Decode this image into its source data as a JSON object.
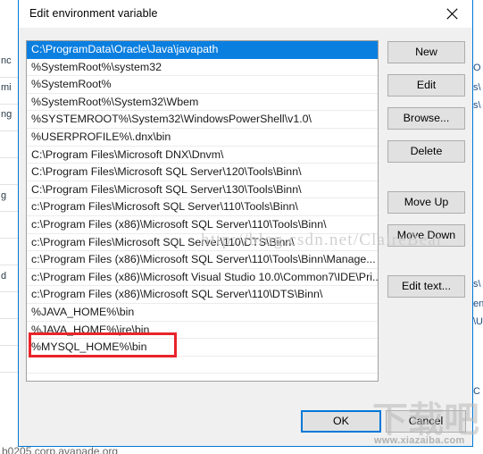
{
  "dialog": {
    "title": "Edit environment variable",
    "close_icon": "close-icon"
  },
  "list": {
    "selected_index": 0,
    "items": [
      "C:\\ProgramData\\Oracle\\Java\\javapath",
      "%SystemRoot%\\system32",
      "%SystemRoot%",
      "%SystemRoot%\\System32\\Wbem",
      "%SYSTEMROOT%\\System32\\WindowsPowerShell\\v1.0\\",
      "%USERPROFILE%\\.dnx\\bin",
      "C:\\Program Files\\Microsoft DNX\\Dnvm\\",
      "C:\\Program Files\\Microsoft SQL Server\\120\\Tools\\Binn\\",
      "C:\\Program Files\\Microsoft SQL Server\\130\\Tools\\Binn\\",
      "c:\\Program Files\\Microsoft SQL Server\\110\\Tools\\Binn\\",
      "c:\\Program Files (x86)\\Microsoft SQL Server\\110\\Tools\\Binn\\",
      "c:\\Program Files\\Microsoft SQL Server\\110\\DTS\\Binn\\",
      "c:\\Program Files (x86)\\Microsoft SQL Server\\110\\Tools\\Binn\\Manage...",
      "c:\\Program Files (x86)\\Microsoft Visual Studio 10.0\\Common7\\IDE\\Pri...",
      "c:\\Program Files (x86)\\Microsoft SQL Server\\110\\DTS\\Binn\\",
      "%JAVA_HOME%\\bin",
      "%JAVA_HOME%\\jre\\bin",
      "%MYSQL_HOME%\\bin"
    ],
    "highlighted_row_index": 17,
    "highlight_color": "#e8242a",
    "selection_color": "#0b7fe0"
  },
  "side_buttons": [
    {
      "label": "New",
      "name": "new-button"
    },
    {
      "label": "Edit",
      "name": "edit-button"
    },
    {
      "label": "Browse...",
      "name": "browse-button"
    },
    {
      "label": "Delete",
      "name": "delete-button"
    },
    {
      "label": "Move Up",
      "name": "move-up-button"
    },
    {
      "label": "Move Down",
      "name": "move-down-button"
    },
    {
      "label": "Edit text...",
      "name": "edit-text-button"
    }
  ],
  "footer": {
    "ok_label": "OK",
    "cancel_label": "Cancel",
    "ok_focus_color": "#0078d7"
  },
  "watermarks": {
    "blog_url": "http://blog.csdn.net/ClaireBear",
    "site_cn": "下载吧",
    "site_url": "www.xiazaiba.com"
  },
  "background": {
    "bottom_text": "b0205.corp.avanade.org",
    "left_fragments": [
      "nc",
      "mi",
      "ng",
      "g",
      "d"
    ],
    "right_fragments": [
      "O",
      "s\\",
      "s\\",
      "s\\",
      "en",
      "\\U",
      "C"
    ]
  }
}
